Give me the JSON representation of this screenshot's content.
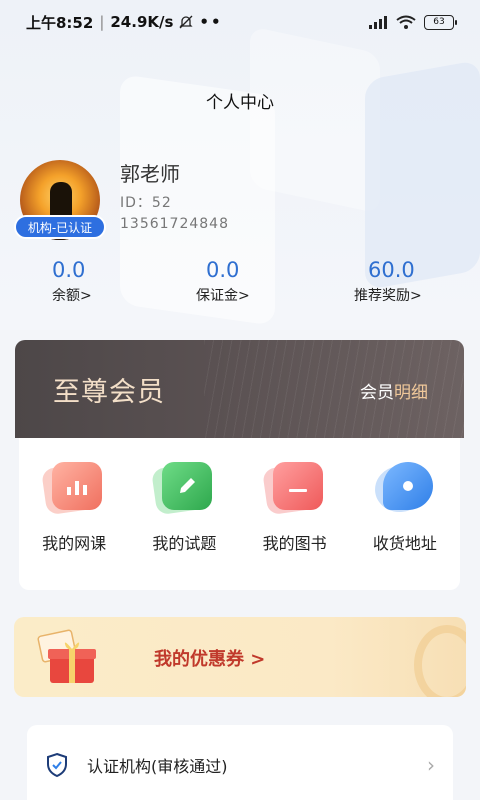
{
  "status_bar": {
    "time": "上午8:52",
    "speed": "24.9K/s",
    "dots": "••",
    "battery": "63"
  },
  "header": {
    "title": "个人中心"
  },
  "profile": {
    "name": "郭老师",
    "id": "ID：52",
    "phone": "13561724848",
    "badge": "机构-已认证"
  },
  "stats": [
    {
      "value": "0.0",
      "label": "余额>"
    },
    {
      "value": "0.0",
      "label": "保证金>"
    },
    {
      "value": "60.0",
      "label": "推荐奖励>"
    }
  ],
  "vip": {
    "title": "至尊会员",
    "detail_prefix": "会员",
    "detail_highlight": "明细"
  },
  "shortcuts": [
    {
      "label": "我的网课",
      "icon": "course-chart-icon",
      "color": "#f0705f"
    },
    {
      "label": "我的试题",
      "icon": "exam-edit-icon",
      "color": "#39b95a"
    },
    {
      "label": "我的图书",
      "icon": "book-icon",
      "color": "#f06060"
    },
    {
      "label": "收货地址",
      "icon": "location-pin-icon",
      "color": "#3d8ff0"
    }
  ],
  "coupon": {
    "label": "我的优惠券 >"
  },
  "menu": [
    {
      "label": "认证机构(审核通过)",
      "icon": "shield-check-icon"
    }
  ],
  "colors": {
    "accent_blue": "#2f6fd0",
    "vip_gold": "#f3dfc8",
    "coupon_red": "#c0392b"
  }
}
